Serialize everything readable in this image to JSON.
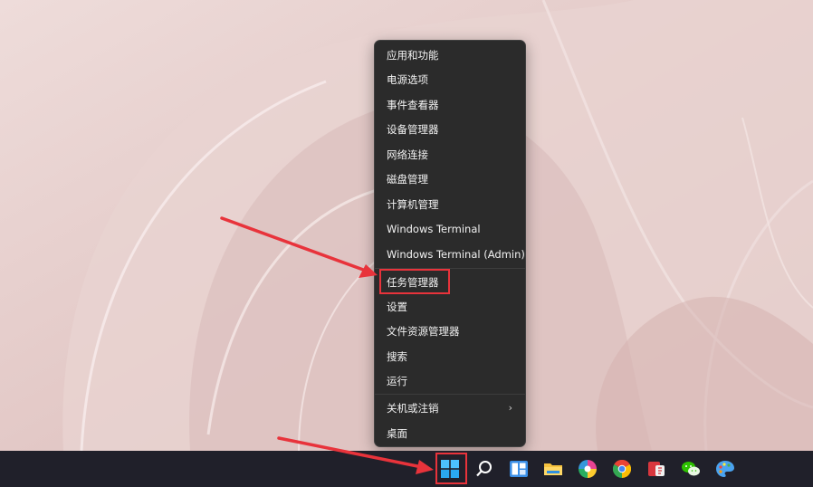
{
  "context_menu": {
    "items": [
      {
        "label": "应用和功能"
      },
      {
        "label": "电源选项"
      },
      {
        "label": "事件查看器"
      },
      {
        "label": "设备管理器"
      },
      {
        "label": "网络连接"
      },
      {
        "label": "磁盘管理"
      },
      {
        "label": "计算机管理"
      },
      {
        "label": "Windows Terminal"
      },
      {
        "label": "Windows Terminal (Admin)"
      },
      {
        "label": "任务管理器"
      },
      {
        "label": "设置"
      },
      {
        "label": "文件资源管理器"
      },
      {
        "label": "搜索"
      },
      {
        "label": "运行"
      },
      {
        "label": "关机或注销",
        "submenu_indicator": "›"
      },
      {
        "label": "桌面"
      }
    ],
    "highlighted_item": "任务管理器"
  },
  "taskbar": {
    "icons": [
      "windows-start-icon",
      "search-icon",
      "widgets-icon",
      "file-explorer-icon",
      "colorful-app-icon",
      "chrome-icon",
      "red-app-icon",
      "wechat-icon",
      "paint-icon"
    ],
    "highlighted_icon": "windows-start-icon"
  },
  "colors": {
    "annotation_red": "#e8333b",
    "menu_bg": "#2b2b2b",
    "taskbar_bg": "#20202a",
    "wallpaper_pink": "#e6cfcd"
  }
}
